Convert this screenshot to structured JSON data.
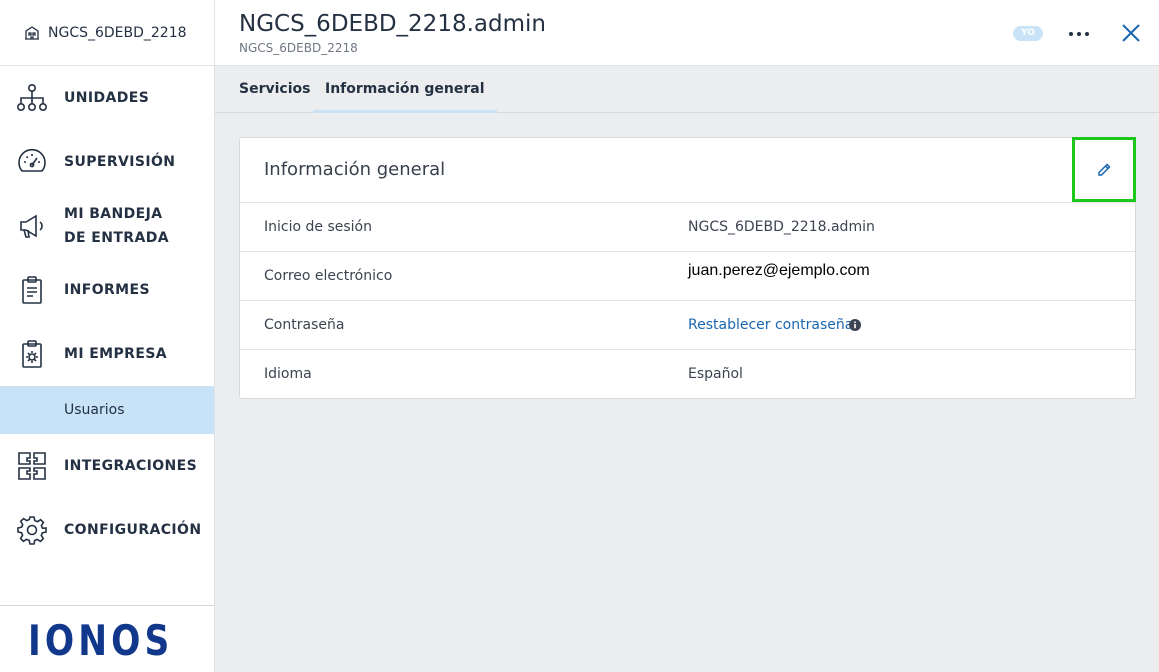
{
  "sidebar": {
    "tenant": "NGCS_6DEBD_2218",
    "items": [
      {
        "label": "UNIDADES",
        "icon": "org-tree-icon"
      },
      {
        "label": "SUPERVISIÓN",
        "icon": "gauge-icon"
      },
      {
        "label": "MI BANDEJA DE ENTRADA",
        "icon": "megaphone-icon"
      },
      {
        "label": "INFORMES",
        "icon": "clipboard-report-icon"
      },
      {
        "label": "MI EMPRESA",
        "icon": "clipboard-gear-icon"
      },
      {
        "label": "INTEGRACIONES",
        "icon": "puzzle-grid-icon"
      },
      {
        "label": "CONFIGURACIÓN",
        "icon": "gear-icon"
      }
    ],
    "sub_item": "Usuarios",
    "logo": "IONOS"
  },
  "header": {
    "title": "NGCS_6DEBD_2218.admin",
    "subtitle": "NGCS_6DEBD_2218",
    "badge": "YO"
  },
  "tabs": [
    {
      "label": "Servicios",
      "active": false
    },
    {
      "label": "Información general",
      "active": true
    }
  ],
  "card": {
    "title": "Información general",
    "rows": [
      {
        "label": "Inicio de sesión",
        "value": "NGCS_6DEBD_2218.admin"
      },
      {
        "label": "Correo electrónico",
        "value": "juan.perez@ejemplo.com"
      },
      {
        "label": "Contraseña",
        "value": "Restablecer contraseña"
      },
      {
        "label": "Idioma",
        "value": "Español"
      }
    ]
  },
  "colors": {
    "accent": "#1a66b0",
    "selected_bg": "#c8e3f7",
    "highlight": "#1cc71c",
    "text": "#243143"
  }
}
